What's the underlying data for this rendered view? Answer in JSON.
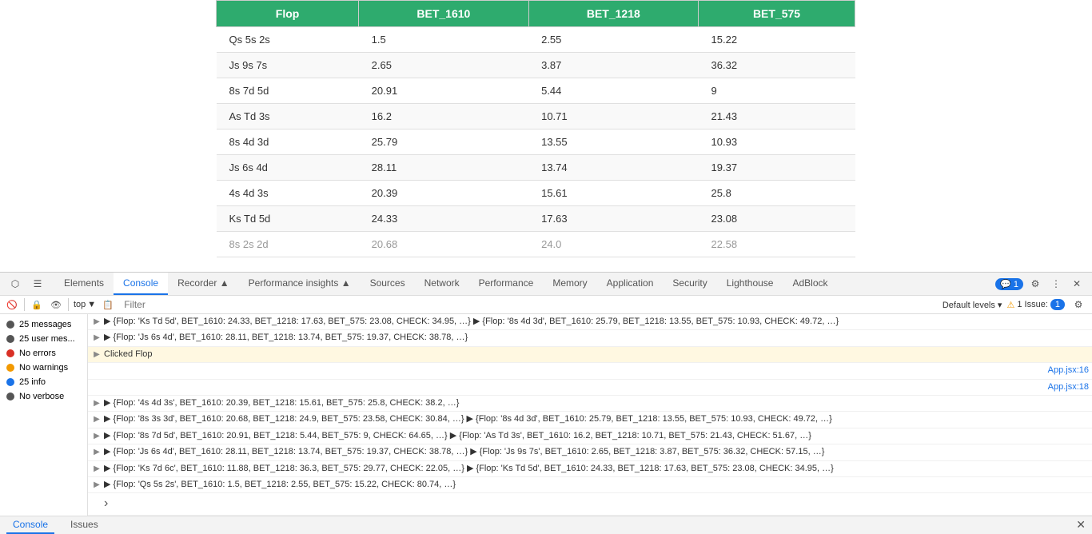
{
  "table": {
    "headers": [
      "Flop",
      "BET_1610",
      "BET_1218",
      "BET_575"
    ],
    "rows": [
      [
        "Qs 5s 2s",
        "1.5",
        "2.55",
        "15.22"
      ],
      [
        "Js 9s 7s",
        "2.65",
        "3.87",
        "36.32"
      ],
      [
        "8s 7d 5d",
        "20.91",
        "5.44",
        "9"
      ],
      [
        "As Td 3s",
        "16.2",
        "10.71",
        "21.43"
      ],
      [
        "8s 4d 3d",
        "25.79",
        "13.55",
        "10.93"
      ],
      [
        "Js 6s 4d",
        "28.11",
        "13.74",
        "19.37"
      ],
      [
        "4s 4d 3s",
        "20.39",
        "15.61",
        "25.8"
      ],
      [
        "Ks Td 5d",
        "24.33",
        "17.63",
        "23.08"
      ],
      [
        "8s 2s 2d",
        "20.68",
        "24.0",
        "22.58"
      ]
    ]
  },
  "devtools": {
    "tabs": [
      {
        "label": "Elements",
        "active": false
      },
      {
        "label": "Console",
        "active": true
      },
      {
        "label": "Recorder ▲",
        "active": false
      },
      {
        "label": "Performance insights ▲",
        "active": false
      },
      {
        "label": "Sources",
        "active": false
      },
      {
        "label": "Network",
        "active": false
      },
      {
        "label": "Performance",
        "active": false
      },
      {
        "label": "Memory",
        "active": false
      },
      {
        "label": "Application",
        "active": false
      },
      {
        "label": "Security",
        "active": false
      },
      {
        "label": "Lighthouse",
        "active": false
      },
      {
        "label": "AdBlock",
        "active": false
      }
    ],
    "badge_count": "1",
    "issue_count": "1 Issue:",
    "filter_placeholder": "Filter",
    "level": "Default levels ▾",
    "sidebar": {
      "items": [
        {
          "label": "25 messages",
          "count": "",
          "icon": "all"
        },
        {
          "label": "25 user mes...",
          "count": "",
          "icon": "user"
        },
        {
          "label": "No errors",
          "count": "",
          "icon": "error"
        },
        {
          "label": "No warnings",
          "count": "",
          "icon": "warning"
        },
        {
          "label": "25 info",
          "count": "",
          "icon": "info"
        },
        {
          "label": "No verbose",
          "count": "",
          "icon": "verbose"
        }
      ]
    },
    "console_lines": [
      {
        "type": "expand",
        "content": "▶ {Flop: 'Ks Td 5d', BET_1610: 24.33, BET_1218: 17.63, BET_575: 23.08, CHECK: 34.95, …} ▶ {Flop: '8s 4d 3d', BET_1610: 25.79, BET_1218: 13.55, BET_575: 10.93, CHECK: 49.72, …}",
        "source": ""
      },
      {
        "type": "expand",
        "content": "▶ {Flop: 'Js 6s 4d', BET_1610: 28.11, BET_1218: 13.74, BET_575: 19.37, CHECK: 38.78, …}",
        "source": ""
      },
      {
        "type": "clicked",
        "content": "Clicked  Flop",
        "source": ""
      },
      {
        "type": "source",
        "content": "",
        "source": "App.jsx:16"
      },
      {
        "type": "source",
        "content": "",
        "source": "App.jsx:18"
      },
      {
        "type": "expand",
        "content": "▶ {Flop: '4s 4d 3s', BET_1610: 20.39, BET_1218: 15.61, BET_575: 25.8, CHECK: 38.2, …}",
        "source": ""
      },
      {
        "type": "expand",
        "content": "▶ {Flop: '8s 3s 3d', BET_1610: 20.68, BET_1218: 24.9, BET_575: 23.58, CHECK: 30.84, …} ▶ {Flop: '8s 4d 3d', BET_1610: 25.79, BET_1218: 13.55, BET_575: 10.93, CHECK: 49.72, …}",
        "source": ""
      },
      {
        "type": "expand",
        "content": "▶ {Flop: '8s 7d 5d', BET_1610: 20.91, BET_1218: 5.44, BET_575: 9, CHECK: 64.65, …} ▶ {Flop: 'As Td 3s', BET_1610: 16.2, BET_1218: 10.71, BET_575: 21.43, CHECK: 51.67, …}",
        "source": ""
      },
      {
        "type": "expand",
        "content": "▶ {Flop: 'Js 6s 4d', BET_1610: 28.11, BET_1218: 13.74, BET_575: 19.37, CHECK: 38.78, …} ▶ {Flop: 'Js 9s 7s', BET_1610: 2.65, BET_1218: 3.87, BET_575: 36.32, CHECK: 57.15, …}",
        "source": ""
      },
      {
        "type": "expand",
        "content": "▶ {Flop: 'Ks 7d 6c', BET_1610: 11.88, BET_1218: 36.3, BET_575: 29.77, CHECK: 22.05, …} ▶ {Flop: 'Ks Td 5d', BET_1610: 24.33, BET_1218: 17.63, BET_575: 23.08, CHECK: 34.95, …}",
        "source": ""
      },
      {
        "type": "expand",
        "content": "▶ {Flop: 'Qs 5s 2s', BET_1610: 1.5, BET_1218: 2.55, BET_575: 15.22, CHECK: 80.74, …}",
        "source": ""
      },
      {
        "type": "prompt",
        "content": "›",
        "source": ""
      }
    ]
  },
  "bottom_tabs": [
    "Console",
    "Issues"
  ],
  "context_label": "top"
}
